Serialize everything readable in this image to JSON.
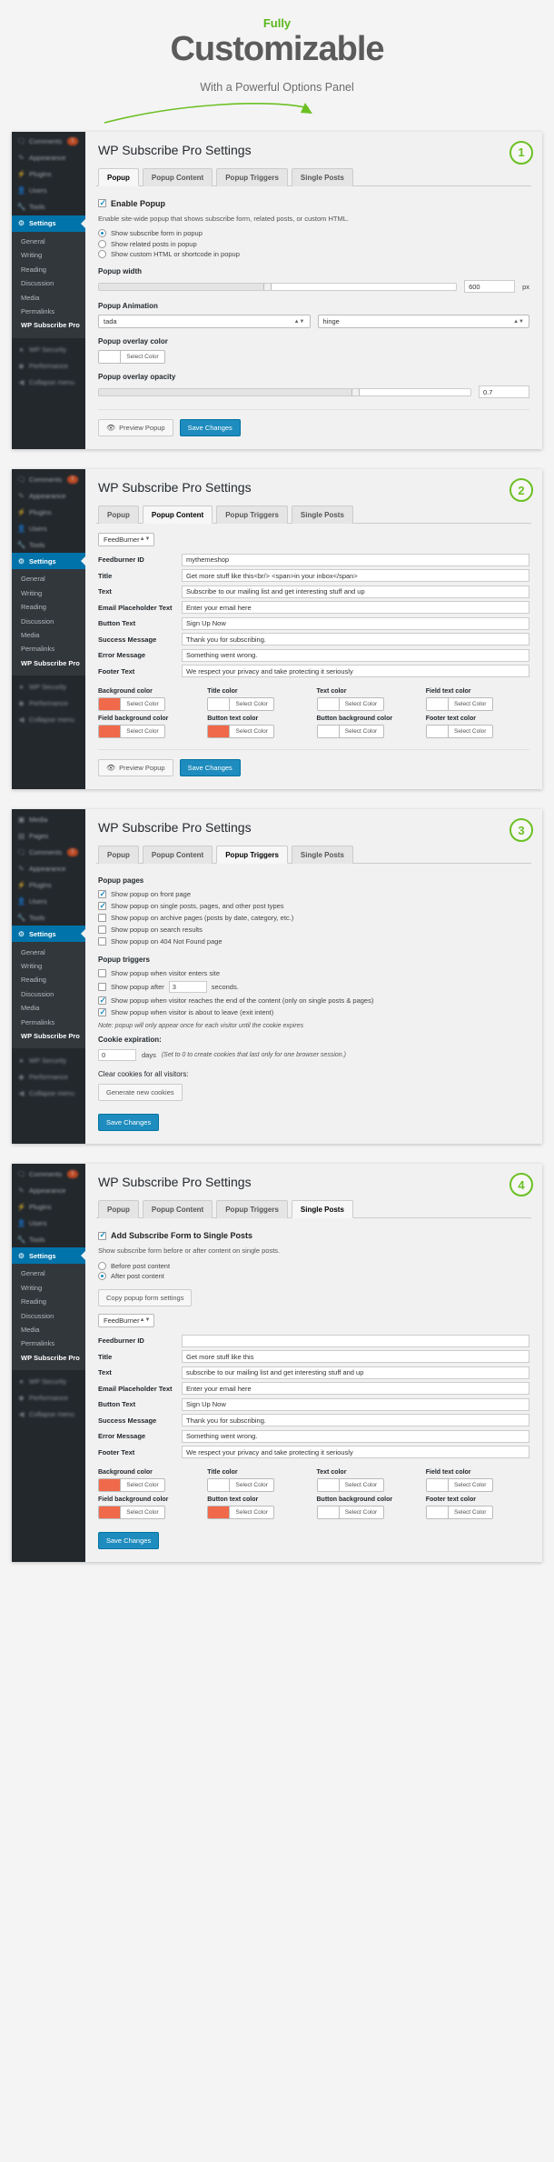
{
  "hero": {
    "eyebrow": "Fully",
    "title": "Customizable",
    "subtitle": "With a Powerful Options Panel",
    "accent_green": "#5bb81c"
  },
  "sidebar": {
    "top_items": [
      {
        "label": "Comments",
        "icon": "comment-icon",
        "badge": "1"
      },
      {
        "label": "Appearance",
        "icon": "brush-icon",
        "badge": ""
      },
      {
        "label": "Plugins",
        "icon": "plug-icon",
        "badge": ""
      },
      {
        "label": "Users",
        "icon": "user-icon",
        "badge": ""
      },
      {
        "label": "Tools",
        "icon": "wrench-icon",
        "badge": ""
      }
    ],
    "extra_items": [
      {
        "label": "Media",
        "icon": "media-icon",
        "badge": ""
      },
      {
        "label": "Pages",
        "icon": "page-icon",
        "badge": ""
      }
    ],
    "active_item": {
      "label": "Settings",
      "icon": "gear-icon"
    },
    "submenu": [
      "General",
      "Writing",
      "Reading",
      "Discussion",
      "Media",
      "Permalinks"
    ],
    "submenu_current": "WP Subscribe Pro",
    "footer_items": [
      {
        "label": "WP Security",
        "icon": "shield-icon"
      },
      {
        "label": "Performance",
        "icon": "speed-icon"
      },
      {
        "label": "Collapse menu",
        "icon": "collapse-icon"
      }
    ]
  },
  "page_title": "WP Subscribe Pro Settings",
  "tabs": [
    "Popup",
    "Popup Content",
    "Popup Triggers",
    "Single Posts"
  ],
  "panel1": {
    "badge": "1",
    "active_tab": "Popup",
    "enable_label": "Enable Popup",
    "enable_checked": true,
    "description": "Enable site-wide popup that shows subscribe form, related posts, or custom HTML.",
    "radios": [
      {
        "label": "Show subscribe form in popup",
        "selected": true
      },
      {
        "label": "Show related posts in popup",
        "selected": false
      },
      {
        "label": "Show custom HTML or shortcode in popup",
        "selected": false
      }
    ],
    "width_label": "Popup width",
    "width_value": "600",
    "width_unit": "px",
    "width_percent": 48,
    "animation_label": "Popup Animation",
    "animation_in": "tada",
    "animation_out": "hinge",
    "overlay_color_label": "Popup overlay color",
    "overlay_color_value": "#ffffff",
    "overlay_color_btn": "Select Color",
    "opacity_label": "Popup overlay opacity",
    "opacity_value": "0.7",
    "opacity_percent": 70,
    "preview_btn": "Preview Popup",
    "save_btn": "Save Changes"
  },
  "panel2": {
    "badge": "2",
    "active_tab": "Popup Content",
    "provider": "FeedBurner",
    "fields": [
      {
        "label": "Feedburner ID",
        "value": "mythemeshop"
      },
      {
        "label": "Title",
        "value": "Get more stuff like this<br/> <span>in your inbox</span>"
      },
      {
        "label": "Text",
        "value": "Subscribe to our mailing list and get interesting stuff and up"
      },
      {
        "label": "Email Placeholder Text",
        "value": "Enter your email here"
      },
      {
        "label": "Button Text",
        "value": "Sign Up Now"
      },
      {
        "label": "Success Message",
        "value": "Thank you for subscribing."
      },
      {
        "label": "Error Message",
        "value": "Something went wrong."
      },
      {
        "label": "Footer Text",
        "value": "We respect your privacy and take protecting it seriously"
      }
    ],
    "colors": [
      {
        "label": "Background color",
        "swatch": "#f0694a",
        "btn": "Select Color"
      },
      {
        "label": "Title color",
        "swatch": "#ffffff",
        "btn": "Select Color"
      },
      {
        "label": "Text color",
        "swatch": "#ffffff",
        "btn": "Select Color"
      },
      {
        "label": "Field text color",
        "swatch": "#ffffff",
        "btn": "Select Color"
      },
      {
        "label": "Field background color",
        "swatch": "#f0694a",
        "btn": "Select Color"
      },
      {
        "label": "Button text color",
        "swatch": "#f0694a",
        "btn": "Select Color"
      },
      {
        "label": "Button background color",
        "swatch": "#ffffff",
        "btn": "Select Color"
      },
      {
        "label": "Footer text color",
        "swatch": "#ffffff",
        "btn": "Select Color"
      }
    ],
    "preview_btn": "Preview Popup",
    "save_btn": "Save Changes"
  },
  "panel3": {
    "badge": "3",
    "active_tab": "Popup Triggers",
    "pages_head": "Popup pages",
    "pages": [
      {
        "label": "Show popup on front page",
        "checked": true
      },
      {
        "label": "Show popup on single posts, pages, and other post types",
        "checked": true
      },
      {
        "label": "Show popup on archive pages (posts by date, category, etc.)",
        "checked": false
      },
      {
        "label": "Show popup on search results",
        "checked": false
      },
      {
        "label": "Show popup on 404 Not Found page",
        "checked": false
      }
    ],
    "triggers_head": "Popup triggers",
    "triggers": [
      {
        "label": "Show popup when visitor enters site",
        "checked": false
      },
      {
        "label": "Show popup after",
        "checked": false,
        "input": "3",
        "suffix": "seconds."
      },
      {
        "label": "Show popup when visitor reaches the end of the content (only on single posts & pages)",
        "checked": true
      },
      {
        "label": "Show popup when visitor is about to leave (exit intent)",
        "checked": true
      }
    ],
    "note": "Note: popup will only appear once for each visitor until the cookie expires",
    "cookie_label": "Cookie expiration:",
    "cookie_value": "0",
    "cookie_unit": "days",
    "cookie_hint": "(Set to 0 to create cookies that last only for one browser session.)",
    "clear_label": "Clear cookies for all visitors:",
    "generate_btn": "Generate new cookies",
    "save_btn": "Save Changes"
  },
  "panel4": {
    "badge": "4",
    "active_tab": "Single Posts",
    "enable_label": "Add Subscribe Form to Single Posts",
    "enable_checked": true,
    "description": "Show subscribe form before or after content on single posts.",
    "radios": [
      {
        "label": "Before post content",
        "selected": false
      },
      {
        "label": "After post content",
        "selected": true
      }
    ],
    "copy_btn": "Copy popup form settings",
    "provider": "FeedBurner",
    "fields": [
      {
        "label": "Feedburner ID",
        "value": ""
      },
      {
        "label": "Title",
        "value": "Get more stuff like this"
      },
      {
        "label": "Text",
        "value": "subscribe to our mailing list and get interesting stuff and up"
      },
      {
        "label": "Email Placeholder Text",
        "value": "Enter your email here"
      },
      {
        "label": "Button Text",
        "value": "Sign Up Now"
      },
      {
        "label": "Success Message",
        "value": "Thank you for subscribing."
      },
      {
        "label": "Error Message",
        "value": "Something went wrong."
      },
      {
        "label": "Footer Text",
        "value": "We respect your privacy and take protecting it seriously"
      }
    ],
    "colors": [
      {
        "label": "Background color",
        "swatch": "#f0694a",
        "btn": "Select Color"
      },
      {
        "label": "Title color",
        "swatch": "#ffffff",
        "btn": "Select Color"
      },
      {
        "label": "Text color",
        "swatch": "#ffffff",
        "btn": "Select Color"
      },
      {
        "label": "Field text color",
        "swatch": "#ffffff",
        "btn": "Select Color"
      },
      {
        "label": "Field background color",
        "swatch": "#f0694a",
        "btn": "Select Color"
      },
      {
        "label": "Button text color",
        "swatch": "#f0694a",
        "btn": "Select Color"
      },
      {
        "label": "Button background color",
        "swatch": "#ffffff",
        "btn": "Select Color"
      },
      {
        "label": "Footer text color",
        "swatch": "#ffffff",
        "btn": "Select Color"
      }
    ],
    "save_btn": "Save Changes"
  }
}
